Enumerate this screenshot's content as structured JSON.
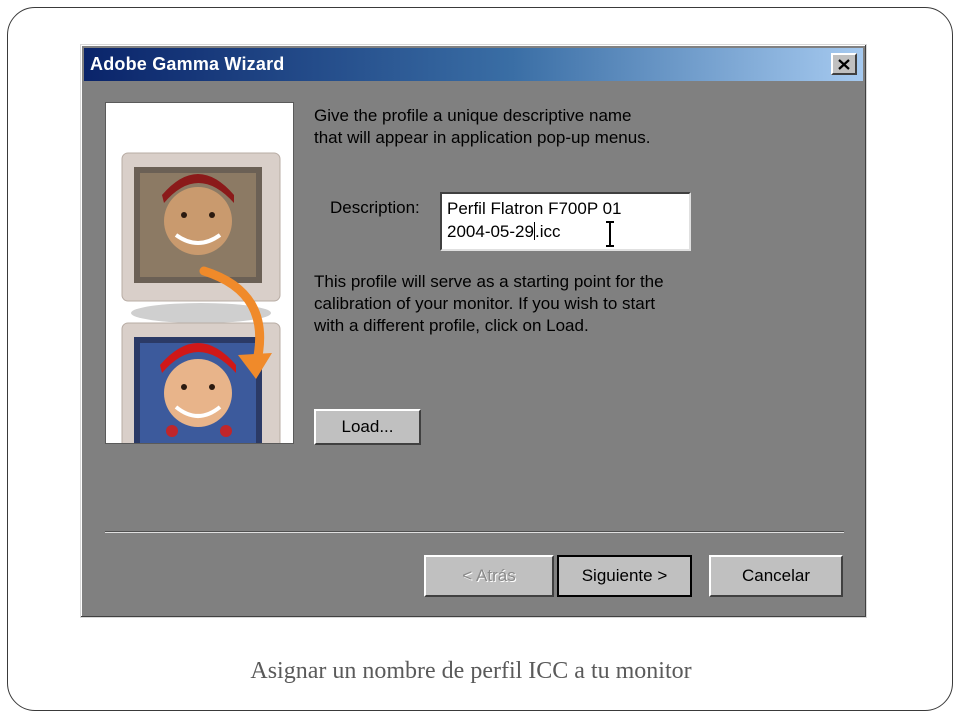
{
  "dialog": {
    "title": "Adobe Gamma Wizard",
    "close_icon": "close-x-icon",
    "instruction_line1": "Give the profile a unique descriptive name",
    "instruction_line2": "that will appear in application pop-up menus.",
    "description_label": "Description:",
    "description_value_line1": "Perfil Flatron F700P 01",
    "description_value_line2_before_caret": "2004-05-29",
    "description_value_line2_after_caret": ".icc",
    "info_line1": "This profile will serve as a starting point for the",
    "info_line2": "calibration of your monitor. If you wish to start",
    "info_line3": "with a different profile, click on Load.",
    "load_label": "Load...",
    "back_label": "< Atrás",
    "next_label": "Siguiente >",
    "cancel_label": "Cancelar"
  },
  "caption": "Asignar un nombre de perfil ICC a tu monitor",
  "colors": {
    "dialog_bg": "#808080",
    "titlebar_start": "#0a246a",
    "titlebar_end": "#a6caf0",
    "button_face": "#c0c0c0",
    "arrow_accent": "#f08a2a"
  }
}
